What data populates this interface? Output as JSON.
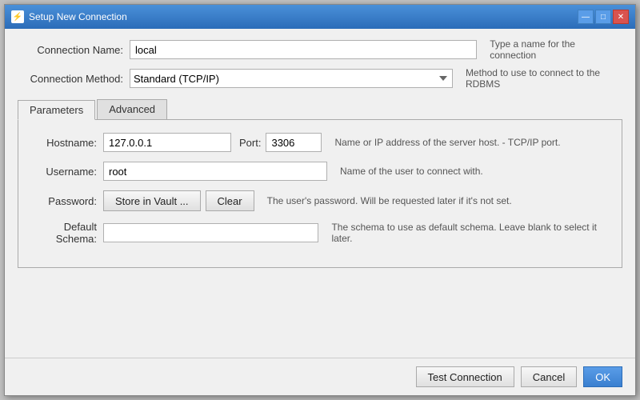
{
  "window": {
    "title": "Setup New Connection",
    "title_icon": "⚡"
  },
  "title_buttons": {
    "minimize": "—",
    "maximize": "□",
    "close": "✕"
  },
  "form": {
    "connection_name_label": "Connection Name:",
    "connection_name_value": "local",
    "connection_name_hint": "Type a name for the connection",
    "connection_method_label": "Connection Method:",
    "connection_method_value": "Standard (TCP/IP)",
    "connection_method_hint": "Method to use to connect to the RDBMS"
  },
  "tabs": [
    {
      "label": "Parameters",
      "active": true
    },
    {
      "label": "Advanced",
      "active": false
    }
  ],
  "params": {
    "hostname_label": "Hostname:",
    "hostname_value": "127.0.0.1",
    "port_label": "Port:",
    "port_value": "3306",
    "hostname_hint": "Name or IP address of the server host.  - TCP/IP port.",
    "username_label": "Username:",
    "username_value": "root",
    "username_hint": "Name of the user to connect with.",
    "password_label": "Password:",
    "store_in_vault_label": "Store in Vault ...",
    "clear_label": "Clear",
    "password_hint": "The user's password. Will be requested later if it's not set.",
    "default_schema_label": "Default Schema:",
    "default_schema_value": "",
    "default_schema_placeholder": "",
    "default_schema_hint": "The schema to use as default schema. Leave blank to select it later."
  },
  "footer": {
    "test_connection_label": "Test Connection",
    "cancel_label": "Cancel",
    "ok_label": "OK"
  }
}
